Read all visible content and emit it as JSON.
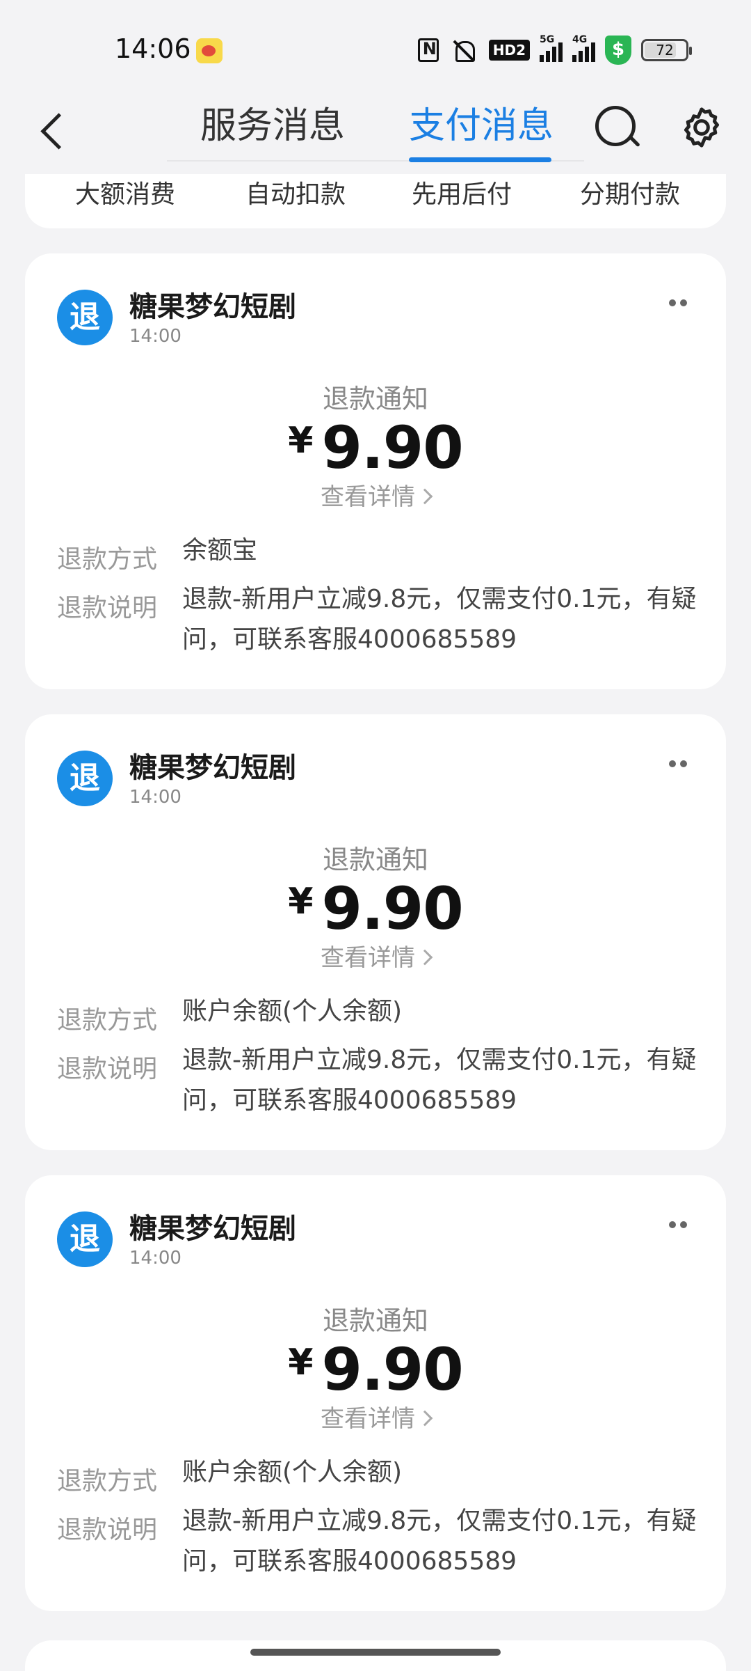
{
  "status_bar": {
    "time": "14:06",
    "battery": "72",
    "signal_labels": [
      "5G",
      "4G"
    ],
    "hd_label": "HD2",
    "shield_symbol": "$",
    "icons": [
      "weibo-icon",
      "nfc-icon",
      "mute-icon",
      "hd-icon",
      "signal-icon",
      "shield-icon",
      "battery-icon"
    ]
  },
  "header": {
    "tabs": [
      {
        "label": "服务消息",
        "active": false
      },
      {
        "label": "支付消息",
        "active": true
      }
    ],
    "accent_color": "#1b7fe3"
  },
  "filters": [
    "大额消费",
    "自动扣款",
    "先用后付",
    "分期付款"
  ],
  "messages": [
    {
      "avatar_text": "退",
      "sender": "糖果梦幻短剧",
      "time": "14:00",
      "notice_title": "退款通知",
      "currency": "¥",
      "amount": "9.90",
      "detail_link": "查看详情",
      "method_label": "退款方式",
      "method_value": "余额宝",
      "note_label": "退款说明",
      "note_value": "退款-新用户立减9.8元，仅需支付0.1元，有疑问，可联系客服4000685589"
    },
    {
      "avatar_text": "退",
      "sender": "糖果梦幻短剧",
      "time": "14:00",
      "notice_title": "退款通知",
      "currency": "¥",
      "amount": "9.90",
      "detail_link": "查看详情",
      "method_label": "退款方式",
      "method_value": "账户余额(个人余额)",
      "note_label": "退款说明",
      "note_value": "退款-新用户立减9.8元，仅需支付0.1元，有疑问，可联系客服4000685589"
    },
    {
      "avatar_text": "退",
      "sender": "糖果梦幻短剧",
      "time": "14:00",
      "notice_title": "退款通知",
      "currency": "¥",
      "amount": "9.90",
      "detail_link": "查看详情",
      "method_label": "退款方式",
      "method_value": "账户余额(个人余额)",
      "note_label": "退款说明",
      "note_value": "退款-新用户立减9.8元，仅需支付0.1元，有疑问，可联系客服4000685589"
    }
  ]
}
